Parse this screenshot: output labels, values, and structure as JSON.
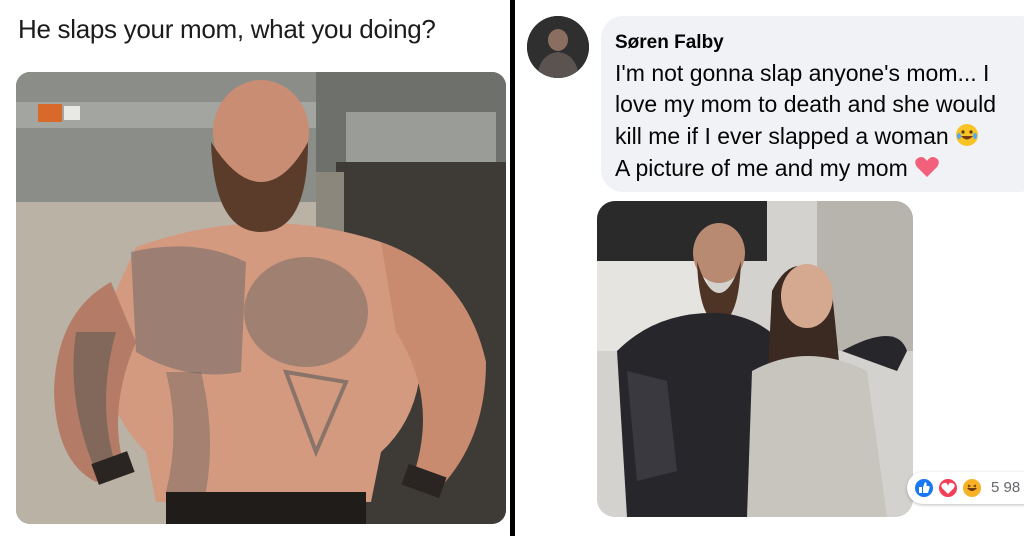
{
  "left_panel": {
    "caption": "He slaps your mom, what you doing?"
  },
  "right_panel": {
    "comment": {
      "author": "Søren Falby",
      "lines": [
        "I'm not gonna slap anyone's mom... I",
        "love my mom to death and she would",
        "kill me if I ever slapped a woman",
        "A picture of me and my mom"
      ],
      "emojis": [
        "laughing-tears-emoji",
        "heart-emoji"
      ]
    },
    "reactions": {
      "icons": [
        "like-icon",
        "love-icon",
        "haha-icon"
      ],
      "count": "5 98"
    }
  },
  "colors": {
    "bubble": "#f0f2f5",
    "like": "#1877f2",
    "love": "#f33e58",
    "haha": "#f7b125",
    "divider": "#000000"
  }
}
